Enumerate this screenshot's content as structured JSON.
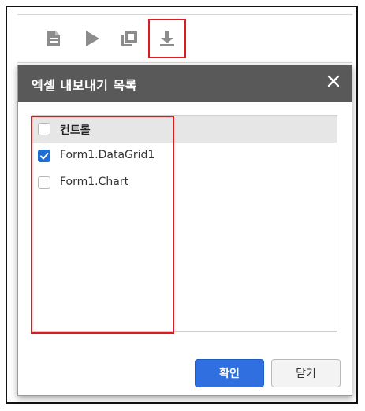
{
  "toolbar": {
    "buttons": [
      {
        "icon": "document-icon",
        "label": ""
      },
      {
        "icon": "play-icon",
        "label": ""
      },
      {
        "icon": "copy-icon",
        "label": ""
      },
      {
        "icon": "download-icon",
        "label": ""
      }
    ],
    "icon_color": "#8c8c8c",
    "highlight_color": "#e0191c"
  },
  "dialog": {
    "title": "엑셀 내보내기 목록",
    "header_color": "#595959",
    "close_icon": "close-icon",
    "list": {
      "header": {
        "label": "컨트롤",
        "checked": false
      },
      "items": [
        {
          "label": "Form1.DataGrid1",
          "checked": true
        },
        {
          "label": "Form1.Chart",
          "checked": false
        }
      ]
    },
    "ok_label": "확인",
    "close_label": "닫기",
    "accent_color": "#2f6fe0"
  }
}
